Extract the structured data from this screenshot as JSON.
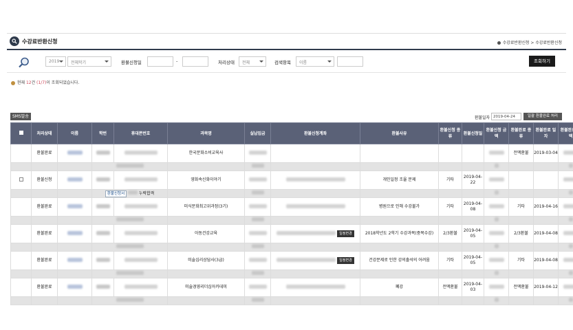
{
  "header": {
    "title": "수강료반환신청",
    "breadcrumb": "수강료반환신청 > 수강료반환신청"
  },
  "filter": {
    "year": "2019",
    "term": "전체학기",
    "date_label": "환불신청일",
    "date_sep": "-",
    "status_label": "처리상태",
    "status_value": "전체",
    "search_label": "검색항목",
    "search_field": "이름",
    "search_button": "조회하기"
  },
  "result_count": {
    "prefix": "현재 ",
    "total": "12",
    "unit": "건 ",
    "page": "(1/7)",
    "suffix": "이 조회되었습니다."
  },
  "toolbar": {
    "sms_button": "SMS발송",
    "refund_date_label": "환불일자",
    "refund_date_value": "2019-04-24",
    "batch_button": "일괄 환불완료 처리"
  },
  "table": {
    "headers": [
      "",
      "처리상태",
      "이름",
      "학번",
      "휴대폰번호",
      "과목명",
      "실납입금",
      "환불신청계좌",
      "환불사유",
      "환불신청 종류",
      "환불신청일",
      "환불신청 금액",
      "환불완료 종류",
      "환불완료 일자",
      "환불완료 금액"
    ],
    "rows": [
      {
        "status": "환불완료",
        "course": "한국문화소비교육사",
        "reason": "",
        "req_type": "",
        "req_date": "",
        "done_type": "전액환불",
        "done_date": "2019-03-04",
        "tag": "",
        "checkbox": false
      },
      {
        "status": "환불신청",
        "course": "영화속신화이야기",
        "reason": "개인일정 조율 문제",
        "req_type": "기타",
        "req_date": "2019-04-22",
        "done_type": "",
        "done_date": "",
        "tag": "",
        "checkbox": true,
        "sub_label": "환불신청서",
        "sub_text": "누락합격"
      },
      {
        "status": "환불완료",
        "course": "미식문화최고위과정(3기)",
        "reason": "병원으로 인해 수강불가",
        "req_type": "기타",
        "req_date": "2019-04-08",
        "done_type": "기타",
        "done_date": "2019-04-16",
        "tag": "",
        "checkbox": false
      },
      {
        "status": "환불완료",
        "course": "아동건강교육",
        "reason": "2018학년도 2학기 수강과목(중복수강)",
        "req_type": "2/3환불",
        "req_date": "2019-04-05",
        "done_type": "2/3환불",
        "done_date": "2019-04-08",
        "tag": "일정변경",
        "checkbox": false
      },
      {
        "status": "환불완료",
        "course": "미술심리상담사(3급)",
        "reason": "건강문제로 인한 강의출석의 어려움",
        "req_type": "기타",
        "req_date": "2019-04-05",
        "done_type": "기타",
        "done_date": "2019-04-08",
        "tag": "일정변경",
        "checkbox": false
      },
      {
        "status": "환불완료",
        "course": "미술경영리더십아카데미",
        "reason": "폐강",
        "req_type": "전액환불",
        "req_date": "2019-04-03",
        "done_type": "전액환불",
        "done_date": "2019-04-12",
        "tag": "",
        "checkbox": false
      }
    ]
  }
}
